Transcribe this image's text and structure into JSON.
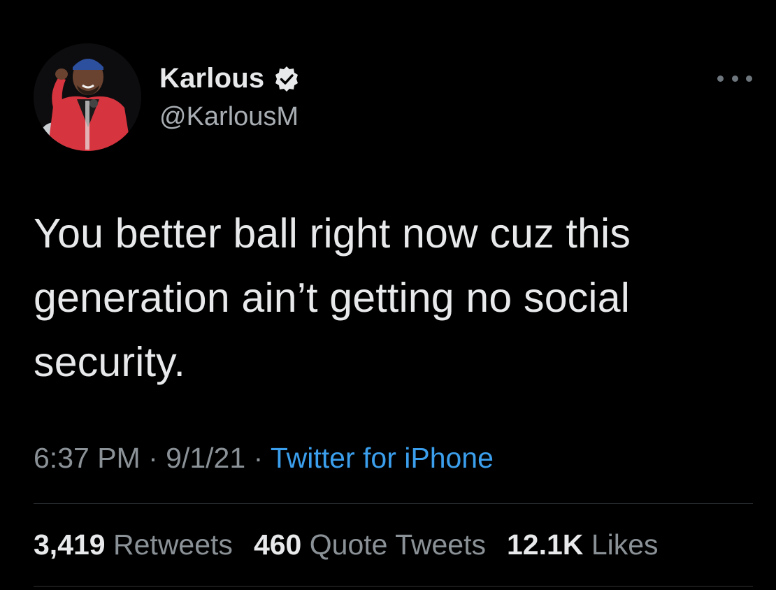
{
  "author": {
    "display_name": "Karlous",
    "handle": "@KarlousM",
    "verified_icon": "verified-badge-icon",
    "avatar": "avatar-photo"
  },
  "tweet": {
    "text": "You better ball right now cuz this generation ain’t getting no social security."
  },
  "meta": {
    "time": "6:37 PM",
    "separator": "·",
    "date": "9/1/21",
    "source": "Twitter for iPhone"
  },
  "stats": {
    "retweets_count": "3,419",
    "retweets_label": "Retweets",
    "quotes_count": "460",
    "quotes_label": "Quote Tweets",
    "likes_count": "12.1K",
    "likes_label": "Likes"
  },
  "colors": {
    "background": "#000000",
    "text_primary": "#e7e9ea",
    "text_secondary": "#8b9297",
    "link": "#3b9fed",
    "divider": "#2f3336"
  }
}
